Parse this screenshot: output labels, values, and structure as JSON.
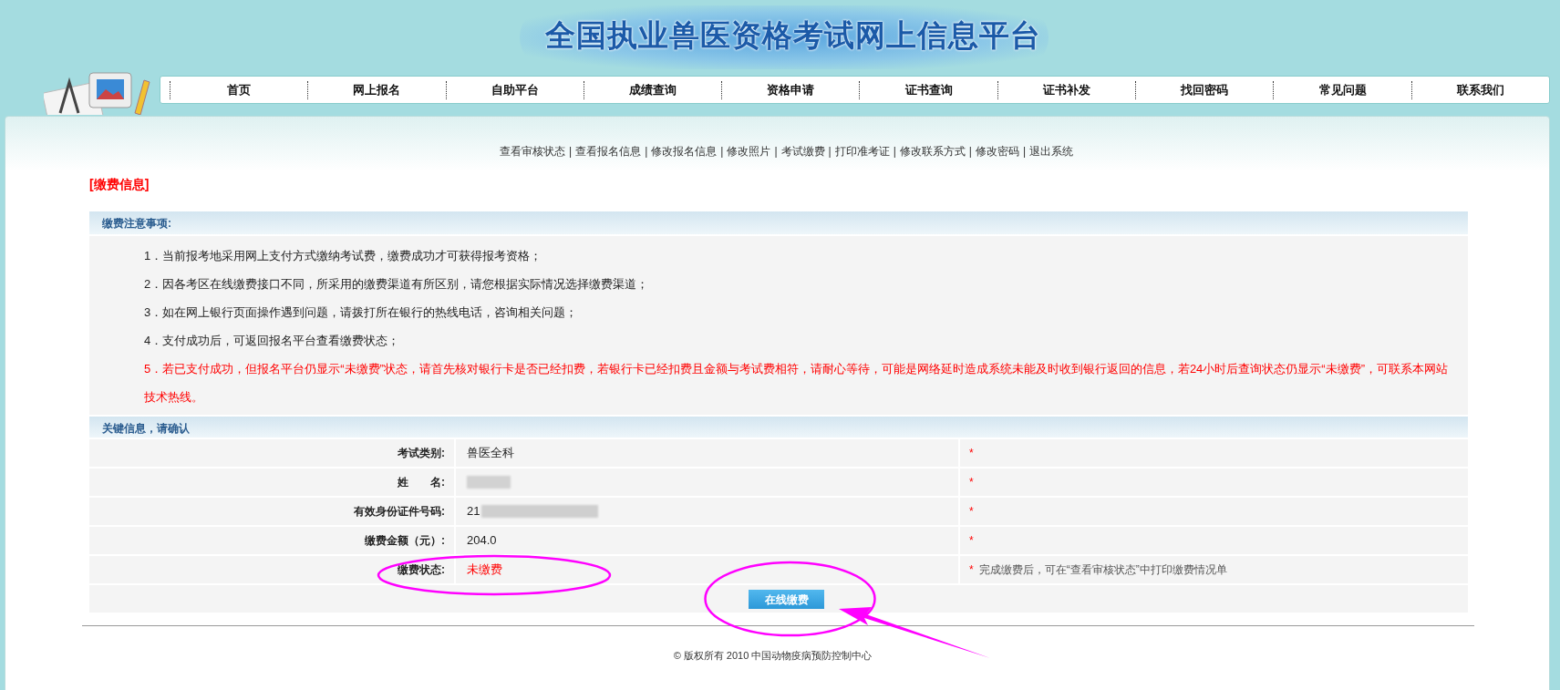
{
  "site_title": "全国执业兽医资格考试网上信息平台",
  "nav": [
    "首页",
    "网上报名",
    "自助平台",
    "成绩查询",
    "资格申请",
    "证书查询",
    "证书补发",
    "找回密码",
    "常见问题",
    "联系我们"
  ],
  "link_separator": "|",
  "sub_links": [
    "查看审核状态",
    "查看报名信息",
    "修改报名信息",
    "修改照片",
    "考试缴费",
    "打印准考证",
    "修改联系方式",
    "修改密码",
    "退出系统"
  ],
  "section_title": "[缴费信息]",
  "notes": {
    "header": "缴费注意事项:",
    "items": [
      {
        "text": "1．当前报考地采用网上支付方式缴纳考试费，缴费成功才可获得报考资格；",
        "warning": false
      },
      {
        "text": "2．因各考区在线缴费接口不同，所采用的缴费渠道有所区别，请您根据实际情况选择缴费渠道；",
        "warning": false
      },
      {
        "text": "3．如在网上银行页面操作遇到问题，请拨打所在银行的热线电话，咨询相关问题；",
        "warning": false
      },
      {
        "text": "4．支付成功后，可返回报名平台查看缴费状态；",
        "warning": false
      },
      {
        "text": "5．若已支付成功，但报名平台仍显示“未缴费”状态，请首先核对银行卡是否已经扣费，若银行卡已经扣费且金额与考试费相符，请耐心等待，可能是网络延时造成系统未能及时收到银行返回的信息，若24小时后查询状态仍显示“未缴费”，可联系本网站技术热线。",
        "warning": true
      }
    ]
  },
  "key_info": {
    "header": "关键信息，请确认",
    "rows": [
      {
        "label": "考试类别:",
        "value": "兽医全科",
        "redacted": false,
        "alert": false,
        "mark": "*"
      },
      {
        "label": "姓　　名:",
        "redacted": true,
        "mark": "*"
      },
      {
        "label": "有效身份证件号码:",
        "value": "21",
        "redacted": true,
        "alert": false,
        "mark": "*"
      },
      {
        "label": "缴费金额（元）:",
        "value": "204.0",
        "redacted": false,
        "alert": false,
        "mark": "*"
      },
      {
        "label": "缴费状态:",
        "value": "未缴费",
        "redacted": false,
        "alert": true,
        "mark": "*",
        "note": "完成缴费后，可在“查看审核状态”中打印缴费情况单"
      }
    ],
    "button": "在线缴费"
  },
  "footer": "© 版权所有 2010 中国动物疫病预防控制中心"
}
